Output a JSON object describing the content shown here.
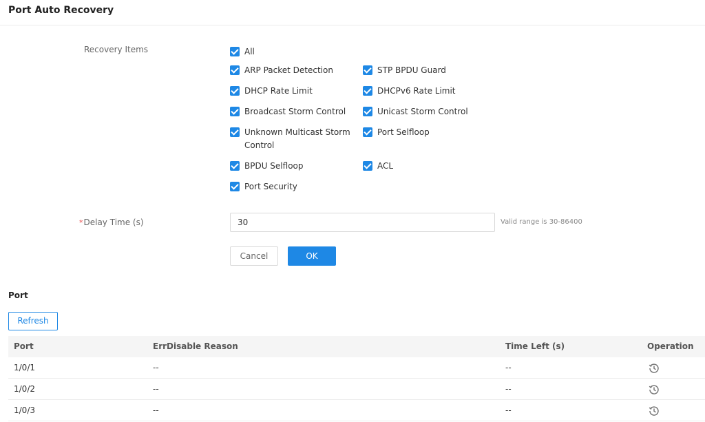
{
  "header": {
    "title": "Port Auto Recovery"
  },
  "recovery": {
    "label": "Recovery Items",
    "items": [
      {
        "label": "All",
        "checked": true
      },
      {
        "label": "ARP Packet Detection",
        "checked": true
      },
      {
        "label": "STP BPDU Guard",
        "checked": true
      },
      {
        "label": "DHCP Rate Limit",
        "checked": true
      },
      {
        "label": "DHCPv6 Rate Limit",
        "checked": true
      },
      {
        "label": "Broadcast Storm Control",
        "checked": true
      },
      {
        "label": "Unicast Storm Control",
        "checked": true
      },
      {
        "label": "Unknown Multicast Storm Control",
        "checked": true
      },
      {
        "label": "Port Selfloop",
        "checked": true
      },
      {
        "label": "BPDU Selfloop",
        "checked": true
      },
      {
        "label": "ACL",
        "checked": true
      },
      {
        "label": "Port Security",
        "checked": true
      }
    ]
  },
  "delay": {
    "required_mark": "*",
    "label": "Delay Time (s)",
    "value": "30",
    "hint": "Valid range is 30-86400"
  },
  "actions": {
    "cancel": "Cancel",
    "ok": "OK"
  },
  "port_section": {
    "title": "Port",
    "refresh": "Refresh",
    "columns": [
      "Port",
      "ErrDisable Reason",
      "Time Left (s)",
      "Operation"
    ],
    "rows": [
      {
        "port": "1/0/1",
        "reason": "--",
        "time_left": "--",
        "operation_icon": "history-icon"
      },
      {
        "port": "1/0/2",
        "reason": "--",
        "time_left": "--",
        "operation_icon": "history-icon"
      },
      {
        "port": "1/0/3",
        "reason": "--",
        "time_left": "--",
        "operation_icon": "history-icon"
      }
    ]
  },
  "colors": {
    "accent": "#1e88e5",
    "required": "#e84a4a"
  }
}
